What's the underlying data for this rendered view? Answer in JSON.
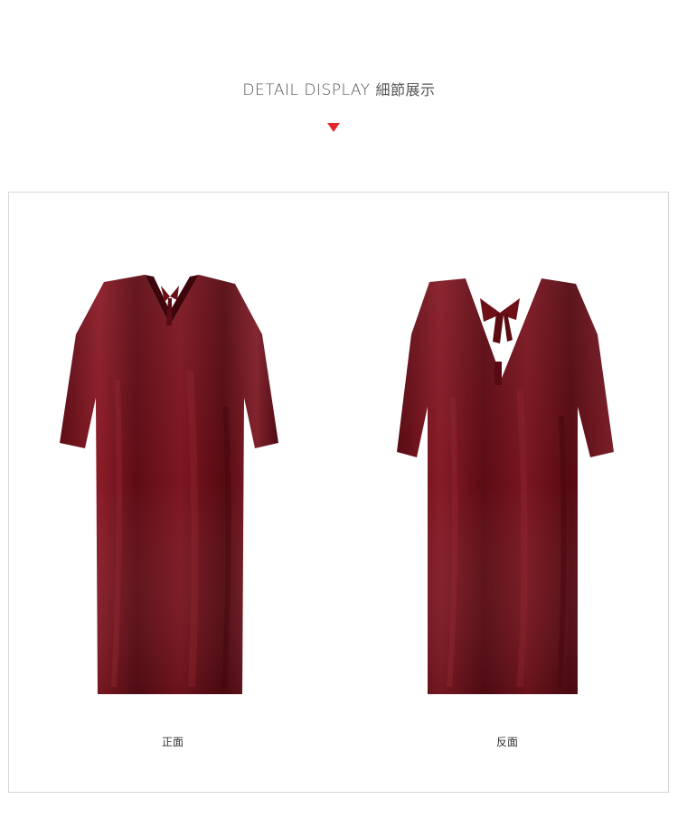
{
  "header": {
    "title_en": "DETAIL DISPLAY",
    "title_zh": "細節展示"
  },
  "colors": {
    "accent": "#e3262b",
    "dress": "#6e0f1a",
    "frame_border": "#d6d6d6"
  },
  "images": {
    "front_caption": "正面",
    "back_caption": "反面"
  }
}
